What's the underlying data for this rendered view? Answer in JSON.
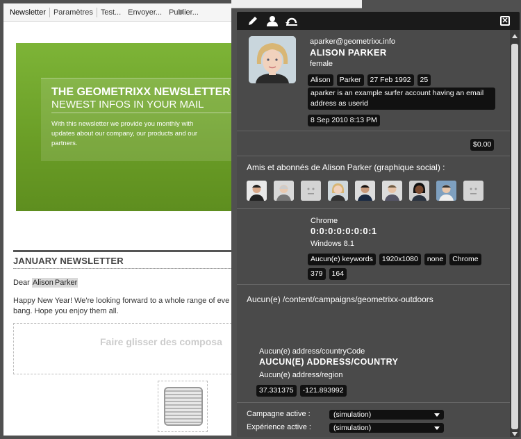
{
  "editor": {
    "tabs": [
      {
        "label": "Newsletter"
      },
      {
        "label": "Paramètres"
      },
      {
        "label": "Test..."
      },
      {
        "label": "Envoyer..."
      },
      {
        "label": "Publier..."
      }
    ],
    "hero": {
      "title1": "THE GEOMETRIXX NEWSLETTER",
      "title2": "NEWEST INFOS IN YOUR MAIL",
      "text": "With this newsletter we provide you monthly with updates about our company, our products and our partners."
    },
    "newsletter": {
      "title": "JANUARY NEWSLETTER",
      "dear": "Dear",
      "first_name": "Alison",
      "last_name": "Parker",
      "body_line1": "Happy New Year! We're looking forward to a whole range of eve",
      "body_line2": "bang. Hope you enjoy them all.",
      "drop_hint": "Faire glisser des composa"
    }
  },
  "panel": {
    "toolbar": {
      "icons": [
        "pencil-icon",
        "user-icon",
        "undo-icon"
      ],
      "close": "✕"
    },
    "profile": {
      "email": "aparker@geometrixx.info",
      "name": "ALISON PARKER",
      "gender": "female",
      "tags": [
        "Alison",
        "Parker",
        "27 Feb 1992",
        "25"
      ],
      "description": "aparker is an example surfer account having an email address as userid",
      "created": "8 Sep 2010 8:13 PM"
    },
    "cart": {
      "total": "$0.00"
    },
    "social": {
      "title": "Amis et abonnés de Alison Parker (graphique social) :",
      "friends": [
        "friend-1",
        "friend-2",
        "friend-3",
        "friend-4",
        "friend-5",
        "friend-6",
        "friend-7",
        "friend-8",
        "friend-9"
      ]
    },
    "tech": {
      "browser": "Chrome",
      "ip": "0:0:0:0:0:0:0:1",
      "os": "Windows 8.1",
      "tags": [
        "Aucun(e) keywords",
        "1920x1080",
        "none",
        "Chrome"
      ],
      "tags2": [
        "379",
        "164"
      ]
    },
    "campaign": {
      "path": "Aucun(e) /content/campaigns/geometrixx-outdoors"
    },
    "geo": {
      "country_code": "Aucun(e) address/countryCode",
      "country": "AUCUN(E) ADDRESS/COUNTRY",
      "region": "Aucun(e) address/region",
      "lat": "37.331375",
      "lon": "-121.893992"
    },
    "active": {
      "campaign_label": "Campagne active :",
      "campaign_value": "(simulation)",
      "experience_label": "Expérience active :",
      "experience_value": "(simulation)"
    }
  }
}
